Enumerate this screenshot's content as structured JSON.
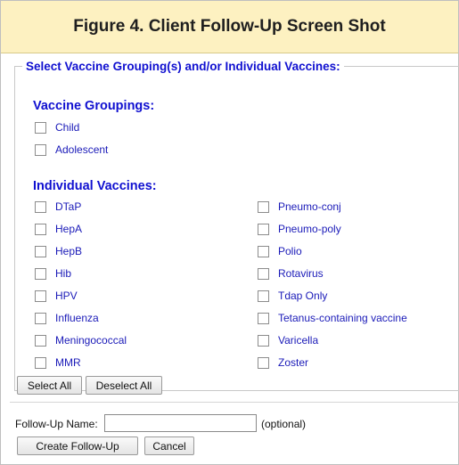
{
  "figure": {
    "title": "Figure 4. Client Follow-Up Screen Shot"
  },
  "selection": {
    "legend": "Select Vaccine Grouping(s) and/or Individual Vaccines:",
    "groupings_heading": "Vaccine Groupings:",
    "groupings": [
      {
        "label": "Child",
        "checked": false
      },
      {
        "label": "Adolescent",
        "checked": false
      }
    ],
    "individual_heading": "Individual Vaccines:",
    "individual_left": [
      {
        "label": "DTaP",
        "checked": false
      },
      {
        "label": "HepA",
        "checked": false
      },
      {
        "label": "HepB",
        "checked": false
      },
      {
        "label": "Hib",
        "checked": false
      },
      {
        "label": "HPV",
        "checked": false
      },
      {
        "label": "Influenza",
        "checked": false
      },
      {
        "label": "Meningococcal",
        "checked": false
      },
      {
        "label": "MMR",
        "checked": false
      }
    ],
    "individual_right": [
      {
        "label": "Pneumo-conj",
        "checked": false
      },
      {
        "label": "Pneumo-poly",
        "checked": false
      },
      {
        "label": "Polio",
        "checked": false
      },
      {
        "label": "Rotavirus",
        "checked": false
      },
      {
        "label": "Tdap Only",
        "checked": false
      },
      {
        "label": "Tetanus-containing vaccine",
        "checked": false
      },
      {
        "label": "Varicella",
        "checked": false
      },
      {
        "label": "Zoster",
        "checked": false
      }
    ],
    "select_all_label": "Select All",
    "deselect_all_label": "Deselect All"
  },
  "follow_up": {
    "name_label": "Follow-Up Name:",
    "name_value": "",
    "optional_note": "(optional)",
    "create_label": "Create Follow-Up",
    "cancel_label": "Cancel"
  }
}
